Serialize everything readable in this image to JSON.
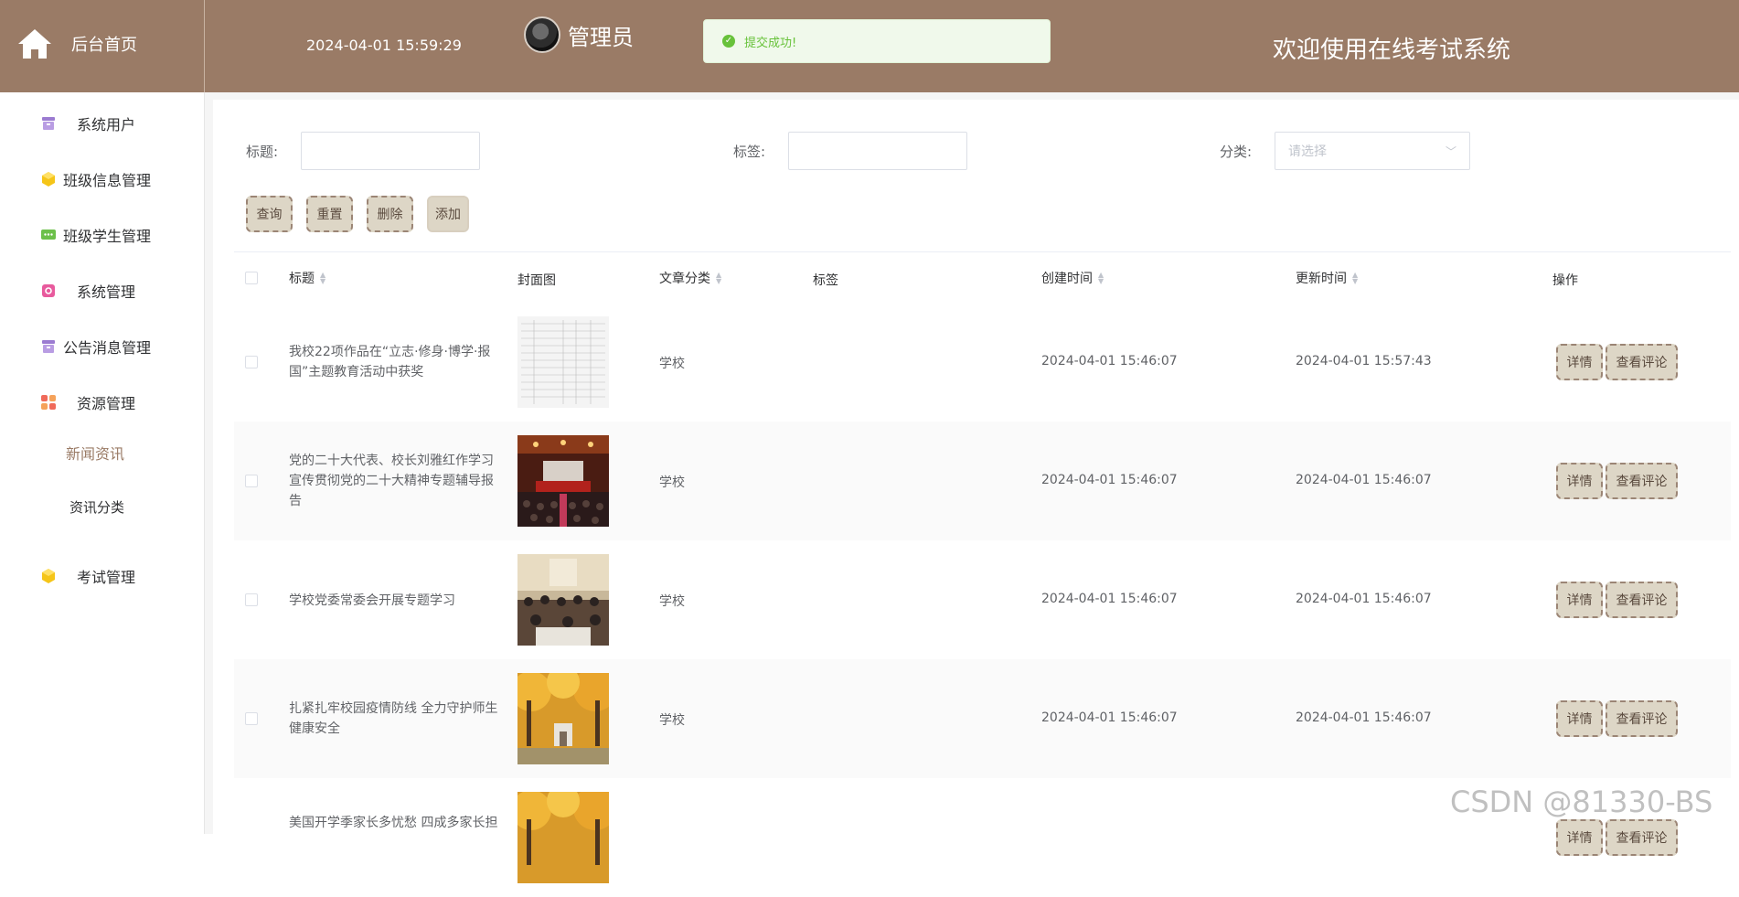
{
  "header": {
    "home_label": "后台首页",
    "datetime": "2024-04-01 15:59:29",
    "user": "管理员",
    "toast": "提交成功!",
    "welcome": "欢迎使用在线考试系统"
  },
  "sidebar": {
    "items": [
      {
        "label": "系统用户",
        "icon": "archive-icon",
        "color": "#9b7bd1"
      },
      {
        "label": "班级信息管理",
        "icon": "cube-icon",
        "color": "#f5c518"
      },
      {
        "label": "班级学生管理",
        "icon": "chat-icon",
        "color": "#6cc04a"
      },
      {
        "label": "系统管理",
        "icon": "settings-box-icon",
        "color": "#e85a9d"
      },
      {
        "label": "公告消息管理",
        "icon": "archive-icon",
        "color": "#9b7bd1"
      },
      {
        "label": "资源管理",
        "icon": "grid-icon",
        "color": "#f06a5a"
      },
      {
        "label": "考试管理",
        "icon": "cube-icon",
        "color": "#f5c518"
      }
    ],
    "sub_items": [
      {
        "label": "新闻资讯",
        "active": true
      },
      {
        "label": "资讯分类",
        "active": false
      }
    ]
  },
  "filters": {
    "title_label": "标题:",
    "tag_label": "标签:",
    "category_label": "分类:",
    "category_placeholder": "请选择",
    "title_value": "",
    "tag_value": ""
  },
  "actions": {
    "query": "查询",
    "reset": "重置",
    "delete": "删除",
    "add": "添加"
  },
  "table": {
    "columns": [
      "标题",
      "封面图",
      "文章分类",
      "标签",
      "创建时间",
      "更新时间",
      "操作"
    ],
    "rows": [
      {
        "title": "我校22项作品在“立志·修身·博学·报国”主题教育活动中获奖",
        "cover": "document-thumbnail",
        "category": "学校",
        "tag": "",
        "created": "2024-04-01 15:46:07",
        "updated": "2024-04-01 15:57:43"
      },
      {
        "title": "党的二十大代表、校长刘雅红作学习宣传贯彻党的二十大精神专题辅导报告",
        "cover": "auditorium-photo",
        "category": "学校",
        "tag": "",
        "created": "2024-04-01 15:46:07",
        "updated": "2024-04-01 15:46:07"
      },
      {
        "title": "学校党委常委会开展专题学习",
        "cover": "meeting-photo",
        "category": "学校",
        "tag": "",
        "created": "2024-04-01 15:46:07",
        "updated": "2024-04-01 15:46:07"
      },
      {
        "title": "扎紧扎牢校园疫情防线 全力守护师生健康安全",
        "cover": "campus-autumn-photo",
        "category": "学校",
        "tag": "",
        "created": "2024-04-01 15:46:07",
        "updated": "2024-04-01 15:46:07"
      },
      {
        "title": "美国开学季家长多忧愁 四成多家长担",
        "cover": "campus-autumn-photo",
        "category": "",
        "tag": "",
        "created": "",
        "updated": ""
      }
    ],
    "row_actions": {
      "detail": "详情",
      "comments": "查看评论"
    }
  },
  "watermark": "CSDN @81330-BS"
}
